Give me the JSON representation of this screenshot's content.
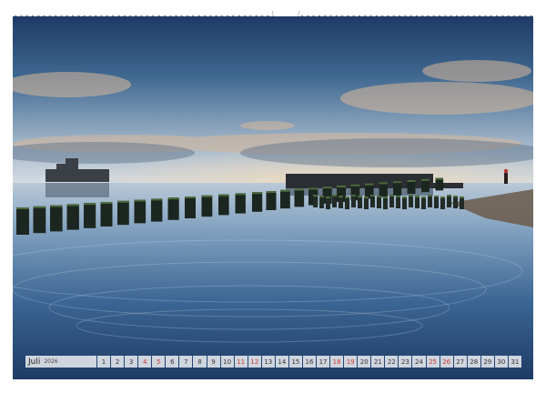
{
  "calendar": {
    "month": "Juli",
    "year": "2026",
    "days": [
      {
        "n": "1",
        "weekend": false
      },
      {
        "n": "2",
        "weekend": false
      },
      {
        "n": "3",
        "weekend": false
      },
      {
        "n": "4",
        "weekend": true
      },
      {
        "n": "5",
        "weekend": true
      },
      {
        "n": "6",
        "weekend": false
      },
      {
        "n": "7",
        "weekend": false
      },
      {
        "n": "8",
        "weekend": false
      },
      {
        "n": "9",
        "weekend": false
      },
      {
        "n": "10",
        "weekend": false
      },
      {
        "n": "11",
        "weekend": true
      },
      {
        "n": "12",
        "weekend": true
      },
      {
        "n": "13",
        "weekend": false
      },
      {
        "n": "14",
        "weekend": false
      },
      {
        "n": "15",
        "weekend": false
      },
      {
        "n": "16",
        "weekend": false
      },
      {
        "n": "17",
        "weekend": false
      },
      {
        "n": "18",
        "weekend": true
      },
      {
        "n": "19",
        "weekend": true
      },
      {
        "n": "20",
        "weekend": false
      },
      {
        "n": "21",
        "weekend": false
      },
      {
        "n": "22",
        "weekend": false
      },
      {
        "n": "23",
        "weekend": false
      },
      {
        "n": "24",
        "weekend": false
      },
      {
        "n": "25",
        "weekend": true
      },
      {
        "n": "26",
        "weekend": true
      },
      {
        "n": "27",
        "weekend": false
      },
      {
        "n": "28",
        "weekend": false
      },
      {
        "n": "29",
        "weekend": false
      },
      {
        "n": "30",
        "weekend": false
      },
      {
        "n": "31",
        "weekend": false
      }
    ],
    "weekend_color": "#d2362e"
  },
  "colors": {
    "sky_top": "#1f3a66",
    "horizon": "#c9d4de",
    "water": "#2d5a8a"
  }
}
